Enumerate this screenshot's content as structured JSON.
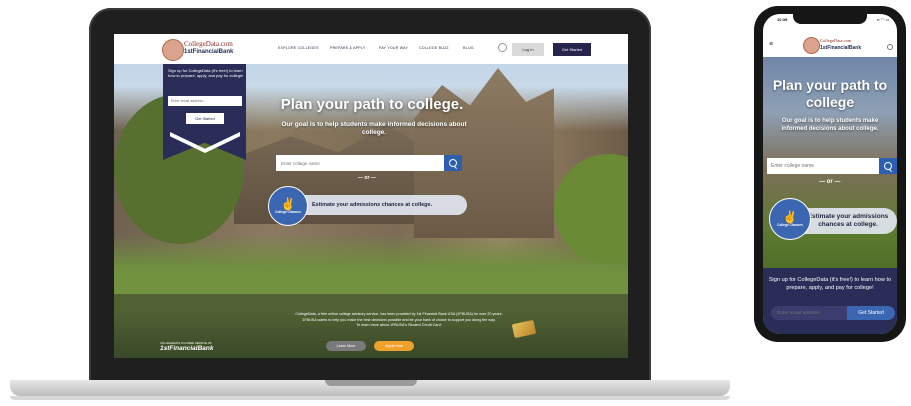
{
  "laptop": {
    "nav": {
      "logo_top": "CollegeData.com",
      "logo_bottom": "1stFinancialBank",
      "links": [
        "EXPLORE COLLEGES",
        "PREPARE & APPLY",
        "PAY YOUR WAY",
        "COLLEGE BUZZ",
        "BLOG"
      ],
      "login_label": "Log In",
      "get_started_label": "Get Started"
    },
    "signup": {
      "text": "Sign up for CollegeData (it's free!) to learn how to prepare, apply, and pay for college!",
      "email_placeholder": "Enter email address",
      "button_label": "Get Started"
    },
    "hero": {
      "title": "Plan your path to college.",
      "subtitle": "Our goal is to help students make informed decisions about college.",
      "college_placeholder": "Enter college name",
      "or_text": "— or —",
      "chances_label": "College Chances",
      "chances_cta": "Estimate your admissions chances at college."
    },
    "footer_band": {
      "text_line1": "CollegeData, a free online college advisory service, has been provided by 1st Financial Bank USA (1FBUSA) for over 20 years.",
      "text_line2": "1FBUSA wants to help you make the best decisions possible and be your bank of choice to support you along the way.",
      "text_line3": "To learn more about 1FBUSA's Student Credit Card:",
      "sponsor_small": "COLLEGEDATA IS A FREE SERVICE OF",
      "sponsor_logo": "1stFinancialBank",
      "learn_more_label": "Learn More",
      "apply_now_label": "Apply Now"
    }
  },
  "phone": {
    "status_time": "10:39",
    "status_icons": "▪▪ ◠ ▭",
    "logo_top": "CollegeData.com",
    "logo_bottom": "1stFinancialBank",
    "title": "Plan your path to college",
    "subtitle": "Our goal is to help students make informed decisions about college.",
    "college_placeholder": "Enter college name",
    "or_text": "— or —",
    "chances_label": "College Chances",
    "chances_cta": "Estimate your admissions chances at college.",
    "signup_text": "Sign up for CollegeData (it's free!) to learn how to prepare, apply, and pay for college!",
    "email_placeholder": "Enter email address",
    "button_label": "Get Started"
  },
  "colors": {
    "navy": "#27244e",
    "blue": "#2d5fb0",
    "orange": "#f0a02c"
  }
}
